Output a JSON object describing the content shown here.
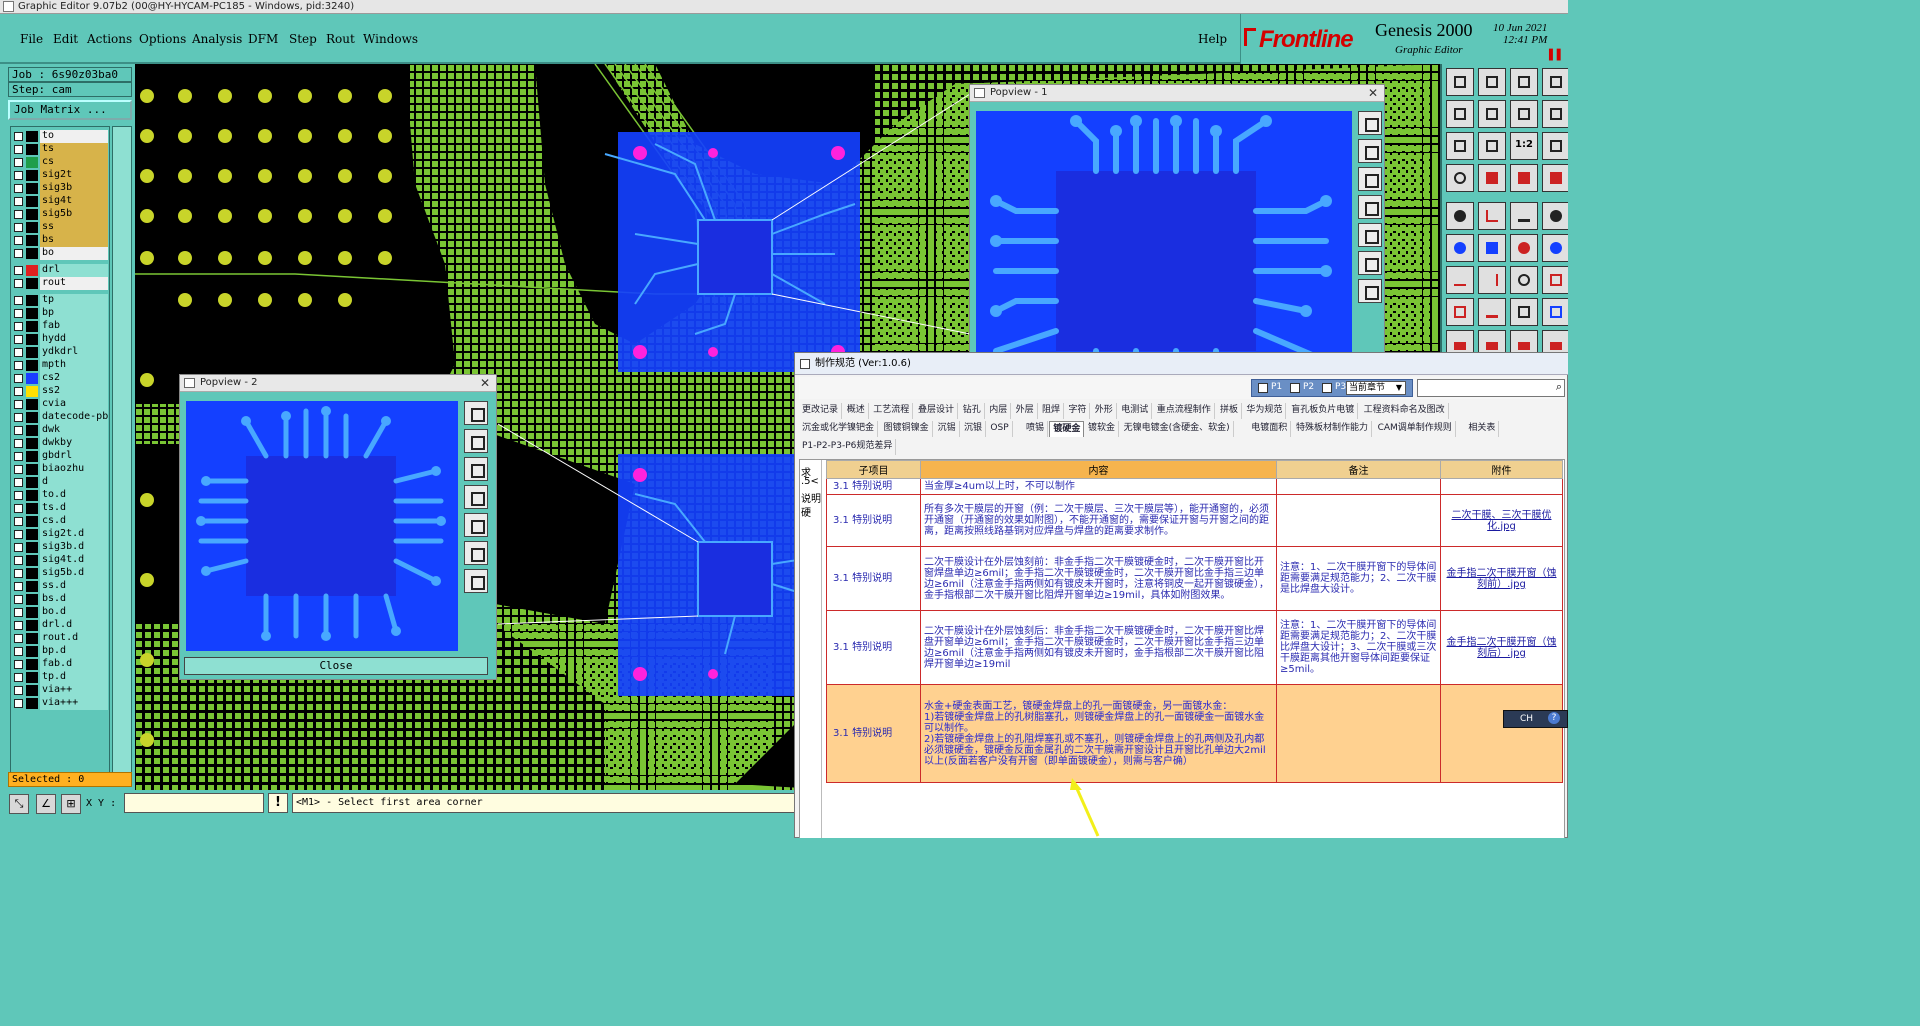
{
  "window": {
    "title": "Graphic Editor 9.07b2 (00@HY-HYCAM-PC185 - Windows, pid:3240)"
  },
  "menu": {
    "items": [
      "File",
      "Edit",
      "Actions",
      "Options",
      "Analysis",
      "DFM",
      "Step",
      "Rout",
      "Windows"
    ],
    "help": "Help"
  },
  "brand": {
    "logo": "Frontline",
    "product": "Genesis 2000",
    "subtitle": "Graphic Editor",
    "date": "10 Jun 2021",
    "time": "12:41 PM"
  },
  "job": {
    "job_line": "Job : 6s90z03ba0",
    "step_line": "Step: cam",
    "matrix_button": "Job Matrix ..."
  },
  "layers": [
    {
      "name": "to",
      "color": "#000000",
      "style": "hl"
    },
    {
      "name": "ts",
      "color": "#000000",
      "style": "sel"
    },
    {
      "name": "cs",
      "color": "#1e9e4a",
      "style": "sel"
    },
    {
      "name": "sig2t",
      "color": "#000000",
      "style": "sel"
    },
    {
      "name": "sig3b",
      "color": "#000000",
      "style": "sel"
    },
    {
      "name": "sig4t",
      "color": "#000000",
      "style": "sel"
    },
    {
      "name": "sig5b",
      "color": "#000000",
      "style": "sel"
    },
    {
      "name": "ss",
      "color": "#000000",
      "style": "sel"
    },
    {
      "name": "bs",
      "color": "#000000",
      "style": "sel"
    },
    {
      "name": "bo",
      "color": "#000000",
      "style": "hl"
    },
    {
      "name": "drl",
      "color": "#e02020",
      "style": "norm"
    },
    {
      "name": "rout",
      "color": "#000000",
      "style": "hl"
    },
    {
      "name": "tp",
      "color": "#000000",
      "style": "norm"
    },
    {
      "name": "bp",
      "color": "#000000",
      "style": "norm"
    },
    {
      "name": "fab",
      "color": "#000000",
      "style": "norm"
    },
    {
      "name": "hydd",
      "color": "#000000",
      "style": "norm"
    },
    {
      "name": "ydkdrl",
      "color": "#000000",
      "style": "norm"
    },
    {
      "name": "mpth",
      "color": "#000000",
      "style": "norm"
    },
    {
      "name": "cs2",
      "color": "#1a3cff",
      "style": "norm"
    },
    {
      "name": "ss2",
      "color": "#ffe000",
      "style": "norm"
    },
    {
      "name": "cvia",
      "color": "#000000",
      "style": "norm"
    },
    {
      "name": "datecode-pbc",
      "color": "#000000",
      "style": "norm"
    },
    {
      "name": "dwk",
      "color": "#000000",
      "style": "norm"
    },
    {
      "name": "dwkby",
      "color": "#000000",
      "style": "norm"
    },
    {
      "name": "gbdrl",
      "color": "#000000",
      "style": "norm"
    },
    {
      "name": "biaozhu",
      "color": "#000000",
      "style": "norm"
    },
    {
      "name": "d",
      "color": "#000000",
      "style": "norm"
    },
    {
      "name": "to.d",
      "color": "#000000",
      "style": "norm"
    },
    {
      "name": "ts.d",
      "color": "#000000",
      "style": "norm"
    },
    {
      "name": "cs.d",
      "color": "#000000",
      "style": "norm"
    },
    {
      "name": "sig2t.d",
      "color": "#000000",
      "style": "norm"
    },
    {
      "name": "sig3b.d",
      "color": "#000000",
      "style": "norm"
    },
    {
      "name": "sig4t.d",
      "color": "#000000",
      "style": "norm"
    },
    {
      "name": "sig5b.d",
      "color": "#000000",
      "style": "norm"
    },
    {
      "name": "ss.d",
      "color": "#000000",
      "style": "norm"
    },
    {
      "name": "bs.d",
      "color": "#000000",
      "style": "norm"
    },
    {
      "name": "bo.d",
      "color": "#000000",
      "style": "norm"
    },
    {
      "name": "drl.d",
      "color": "#000000",
      "style": "norm"
    },
    {
      "name": "rout.d",
      "color": "#000000",
      "style": "norm"
    },
    {
      "name": "bp.d",
      "color": "#000000",
      "style": "norm"
    },
    {
      "name": "fab.d",
      "color": "#000000",
      "style": "norm"
    },
    {
      "name": "tp.d",
      "color": "#000000",
      "style": "norm"
    },
    {
      "name": "via++",
      "color": "#000000",
      "style": "norm"
    },
    {
      "name": "via+++",
      "color": "#000000",
      "style": "norm"
    }
  ],
  "selected": "Selected : 0",
  "status": {
    "xy_label": "X Y :",
    "xy_value": "",
    "prompt": "<M1> - Select first area corner"
  },
  "popview1": {
    "title": "Popview - 1"
  },
  "popview2": {
    "title": "Popview - 2",
    "close_label": "Close"
  },
  "spec": {
    "title": "制作规范 (Ver:1.0.6)",
    "filters": [
      "P1",
      "P2",
      "P3"
    ],
    "chapter": "当前章节",
    "tab_rows": [
      [
        "更改记录",
        "概述",
        "工艺流程",
        "叠层设计",
        "钻孔",
        "内层",
        "外层",
        "阻焊",
        "字符",
        "外形",
        "电测试",
        "重点流程制作",
        "拼板",
        "华为规范",
        "盲孔板负片电镀",
        "工程资料命名及图改"
      ],
      [
        "沉金或化学镍钯金",
        "图镀铜镍金",
        "沉锡",
        "沉银",
        "OSP",
        "喷锡",
        "镀硬金",
        "镀软金",
        "无镍电镀金(含硬金、软金)",
        "电镀面积",
        "特殊板材制作能力",
        "CAM调单制作规则",
        "相关表"
      ],
      [
        "P1-P2-P3-P6规范差异"
      ]
    ],
    "active_tab": "镀硬金",
    "left_strip": [
      "求",
      ".5<",
      "说明",
      "硬"
    ],
    "headers": [
      "子项目",
      "内容",
      "备注",
      "附件"
    ],
    "rows": [
      {
        "sub": "3.1 特别说明",
        "content": "当金厚≥4um以上时，不可以制作",
        "note": "",
        "attach": ""
      },
      {
        "sub": "3.1 特别说明",
        "content": "所有多次干膜层的开窗（例：二次干膜层、三次干膜层等），能开通窗的，必须开通窗（开通窗的效果如附图），不能开通窗的，需要保证开窗与开窗之间的距离，距离按照线路基铜对应焊盘与焊盘的距离要求制作。",
        "note": "",
        "attach": "二次干膜、三次干膜优化.jpg"
      },
      {
        "sub": "3.1 特别说明",
        "content": "二次干膜设计在外层蚀刻前：非金手指二次干膜镀硬金时，二次干膜开窗比开窗焊盘单边≥6mil；金手指二次干膜镀硬金时，二次干膜开窗比金手指三边单边≥6mil（注意金手指两侧如有镀皮未开窗时，注意将铜皮一起开窗镀硬金），金手指根部二次干膜开窗比阻焊开窗单边≥19mil，具体如附图效果。",
        "note": "注意：1、二次干膜开窗下的导体间距需要满足规范能力；2、二次干膜是比焊盘大设计。",
        "attach": "金手指二次干膜开窗（蚀刻前）.jpg"
      },
      {
        "sub": "3.1 特别说明",
        "content": "二次干膜设计在外层蚀刻后：非金手指二次干膜镀硬金时，二次干膜开窗比焊盘开窗单边≥6mil；金手指二次干膜镀硬金时，二次干膜开窗比金手指三边单边≥6mil（注意金手指两侧如有镀皮未开窗时，金手指根部二次干膜开窗比阻焊开窗单边≥19mil",
        "note": "注意：1、二次干膜开窗下的导体间距需要满足规范能力；2、二次干膜比焊盘大设计；3、二次干膜或三次干膜距离其他开窗导体间距要保证≥5mil。",
        "attach": "金手指二次干膜开窗（蚀刻后）.jpg"
      },
      {
        "sub": "3.1 特别说明",
        "content": "水金+硬金表面工艺，镀硬金焊盘上的孔一面镀硬金，另一面镀水金：\n1)若镀硬金焊盘上的孔树脂塞孔，则镀硬金焊盘上的孔一面镀硬金一面镀水金可以制作。\n2)若镀硬金焊盘上的孔阻焊塞孔或不塞孔，则镀硬金焊盘上的孔两侧及孔内都必须镀硬金，镀硬金反面金属孔的二次干膜需开窗设计且开窗比孔单边大2mil以上(反面若客户没有开窗（即单面镀硬金），则需与客户确）",
        "note": "",
        "attach": ""
      }
    ]
  },
  "ime": {
    "label": "CH"
  },
  "colors": {
    "teal": "#5fc7b9",
    "pcb_green": "#7ac534",
    "copper_blue": "#1440ff",
    "trace_blue": "#48a8ff",
    "pad_magenta": "#ff22dd"
  }
}
